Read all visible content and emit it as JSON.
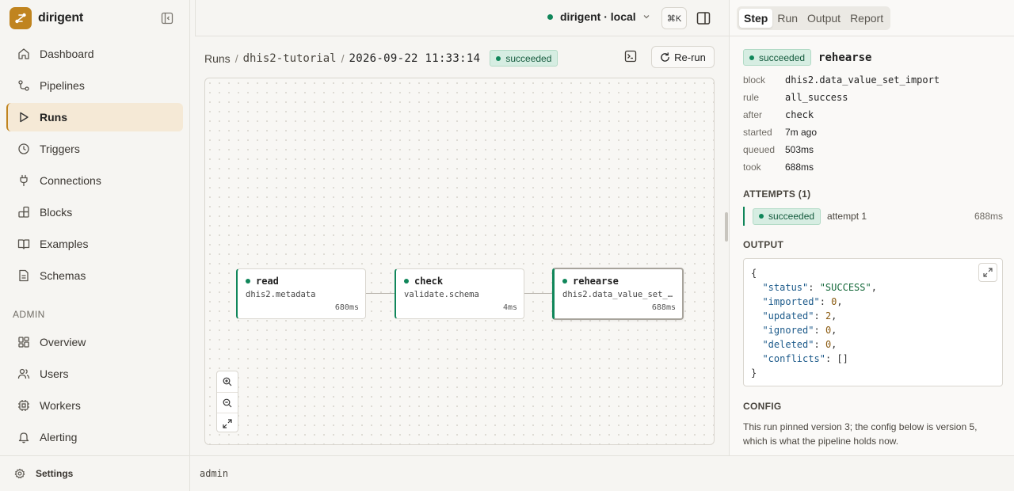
{
  "app": {
    "name": "dirigent"
  },
  "sidebar": {
    "items": [
      {
        "label": "Dashboard"
      },
      {
        "label": "Pipelines"
      },
      {
        "label": "Runs"
      },
      {
        "label": "Triggers"
      },
      {
        "label": "Connections"
      },
      {
        "label": "Blocks"
      },
      {
        "label": "Examples"
      },
      {
        "label": "Schemas"
      }
    ],
    "admin_label": "ADMIN",
    "admin_items": [
      {
        "label": "Overview"
      },
      {
        "label": "Users"
      },
      {
        "label": "Workers"
      },
      {
        "label": "Alerting"
      }
    ],
    "settings_label": "Settings"
  },
  "topbar": {
    "environment": "dirigent · local",
    "shortcut": "⌘K"
  },
  "breadcrumb": {
    "items": [
      "Runs",
      "dhis2-tutorial"
    ],
    "current": "2026-09-22 11:33:14",
    "status": "succeeded"
  },
  "actions": {
    "rerun_label": "Re-run"
  },
  "graph": {
    "nodes": [
      {
        "name": "read",
        "block": "dhis2.metadata",
        "duration": "680ms"
      },
      {
        "name": "check",
        "block": "validate.schema",
        "duration": "4ms"
      },
      {
        "name": "rehearse",
        "block": "dhis2.data_value_set_import",
        "duration": "688ms"
      }
    ]
  },
  "panel": {
    "tabs": [
      "Step",
      "Run",
      "Output",
      "Report"
    ],
    "active_tab": "Step",
    "step": {
      "status": "succeeded",
      "name": "rehearse",
      "fields": [
        {
          "key": "block",
          "value": "dhis2.data_value_set_import"
        },
        {
          "key": "rule",
          "value": "all_success"
        },
        {
          "key": "after",
          "value": "check"
        },
        {
          "key": "started",
          "value": "7m ago"
        },
        {
          "key": "queued",
          "value": "503ms"
        },
        {
          "key": "took",
          "value": "688ms"
        }
      ]
    },
    "attempts_title": "ATTEMPTS (1)",
    "attempt": {
      "status": "succeeded",
      "label": "attempt 1",
      "duration": "688ms"
    },
    "output_title": "OUTPUT",
    "output": {
      "open": "{",
      "close": "}",
      "entries": [
        {
          "key": "\"status\"",
          "value": "\"SUCCESS\"",
          "kind": "str",
          "comma": ","
        },
        {
          "key": "\"imported\"",
          "value": "0",
          "kind": "num",
          "comma": ","
        },
        {
          "key": "\"updated\"",
          "value": "2",
          "kind": "num",
          "comma": ","
        },
        {
          "key": "\"ignored\"",
          "value": "0",
          "kind": "num",
          "comma": ","
        },
        {
          "key": "\"deleted\"",
          "value": "0",
          "kind": "num",
          "comma": ","
        },
        {
          "key": "\"conflicts\"",
          "value": "[]",
          "kind": "plain",
          "comma": ""
        }
      ]
    },
    "config_title": "CONFIG",
    "config_note": "This run pinned version 3; the config below is version 5, which is what the pipeline holds now."
  },
  "footer": {
    "user": "admin"
  },
  "colors": {
    "accent": "#c0841f",
    "success": "#10865a",
    "success_bg": "#d6ede2"
  }
}
